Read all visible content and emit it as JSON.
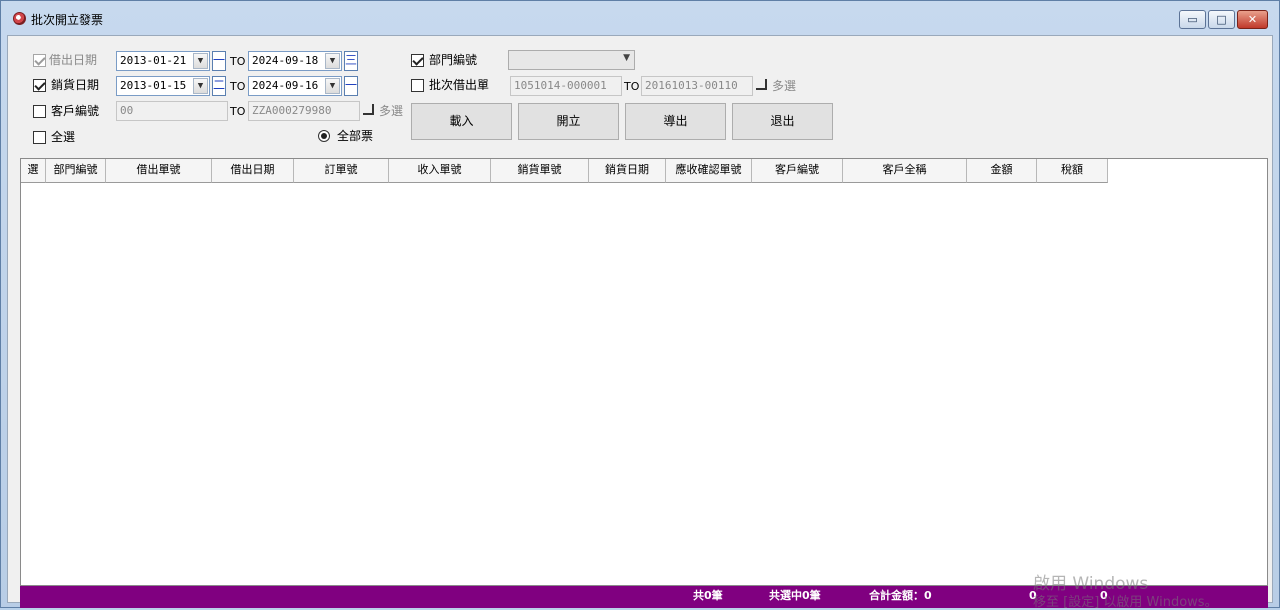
{
  "window": {
    "title": "批次開立發票",
    "buttons": {
      "minimize": "▭",
      "maximize": "□",
      "close": "✕"
    }
  },
  "filters": {
    "loan_date": {
      "label": "借出日期",
      "checked": true,
      "enabled": false,
      "from": "2013-01-21",
      "to_label": "TO",
      "to": "2024-09-18",
      "op1": "一",
      "op2": "三"
    },
    "sales_date": {
      "label": "銷貨日期",
      "checked": true,
      "from": "2013-01-15",
      "to_label": "TO",
      "to": "2024-09-16",
      "op1": "二",
      "op2": "一"
    },
    "customer_no": {
      "label": "客戶編號",
      "checked": false,
      "from": "00",
      "to_label": "TO",
      "to": "ZZA000279980",
      "multi_label": "多選"
    },
    "select_all": {
      "label": "全選",
      "checked": false
    },
    "all_invoices": {
      "label": "全部票",
      "selected": true
    },
    "dept_no": {
      "label": "部門編號",
      "checked": true,
      "value": ""
    },
    "batch_loan": {
      "label": "批次借出單",
      "checked": false,
      "from": "1051014-000001",
      "to_label": "TO",
      "to": "20161013-00110",
      "multi_label": "多選"
    }
  },
  "actions": {
    "load": "載入",
    "issue": "開立",
    "export": "導出",
    "exit": "退出"
  },
  "grid": {
    "columns": [
      "選",
      "部門編號",
      "借出單號",
      "借出日期",
      "訂單號",
      "收入單號",
      "銷貨單號",
      "銷貨日期",
      "應收確認單號",
      "客戶編號",
      "客戶全稱",
      "金額",
      "稅額"
    ],
    "rows": []
  },
  "status": {
    "total": "共0筆",
    "selected": "共選中0筆",
    "sum_label": "合計金額：0",
    "value1": "0",
    "value2": "0",
    "color": "#800080"
  },
  "watermark": {
    "line1": "啟用 Windows",
    "line2": "移至 [設定] 以啟用 Windows。"
  }
}
